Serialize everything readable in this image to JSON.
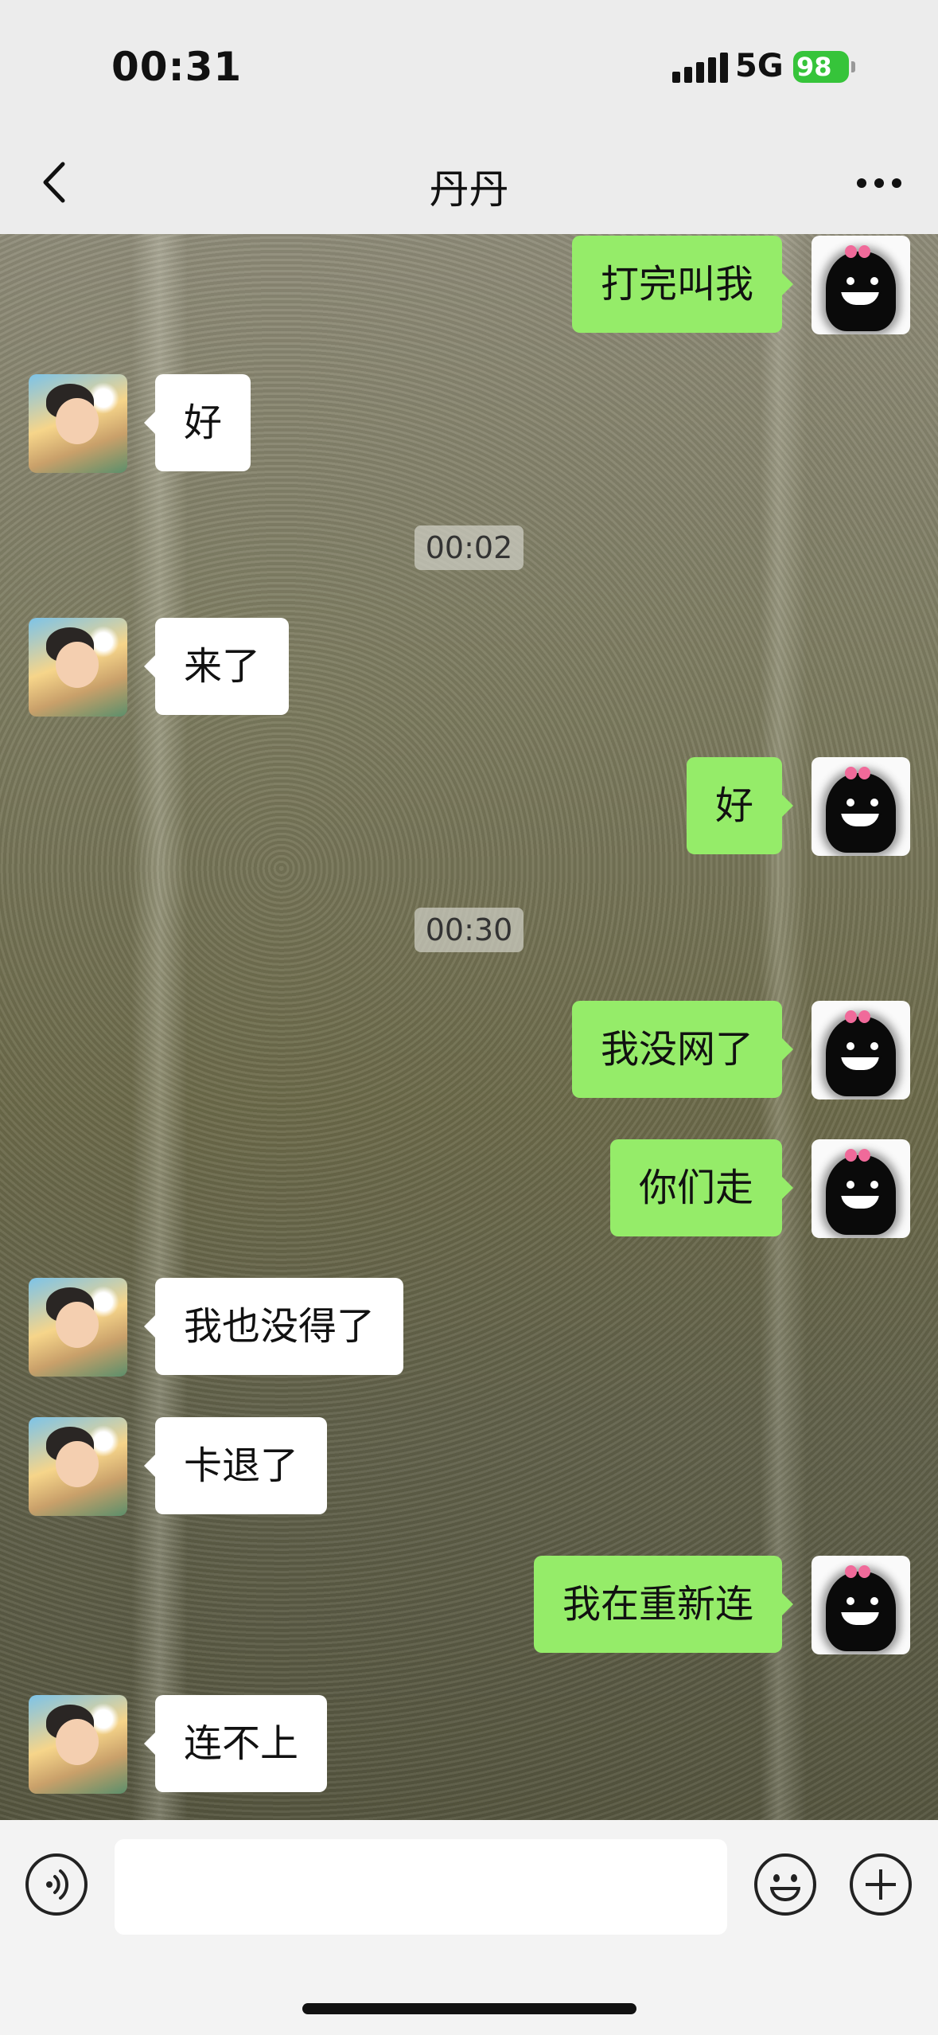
{
  "status_bar": {
    "time": "00:31",
    "network": "5G",
    "battery": "98"
  },
  "nav": {
    "title": "丹丹",
    "back_icon": "chevron-left-icon",
    "more_icon": "ellipsis-icon"
  },
  "messages": [
    {
      "side": "me",
      "text": "打完叫我"
    },
    {
      "side": "other",
      "text": "好"
    },
    {
      "type": "time",
      "text": "00:02"
    },
    {
      "side": "other",
      "text": "来了"
    },
    {
      "side": "me",
      "text": "好"
    },
    {
      "type": "time",
      "text": "00:30"
    },
    {
      "side": "me",
      "text": "我没网了"
    },
    {
      "side": "me",
      "text": "你们走"
    },
    {
      "side": "other",
      "text": "我也没得了"
    },
    {
      "side": "other",
      "text": "卡退了"
    },
    {
      "side": "me",
      "text": "我在重新连"
    },
    {
      "side": "other",
      "text": "连不上"
    }
  ],
  "input_bar": {
    "voice_icon": "voice-icon",
    "emoji_icon": "emoji-icon",
    "plus_icon": "plus-icon",
    "text_value": ""
  },
  "colors": {
    "my_bubble": "#95ec69",
    "other_bubble": "#ffffff",
    "battery": "#36c43a"
  }
}
